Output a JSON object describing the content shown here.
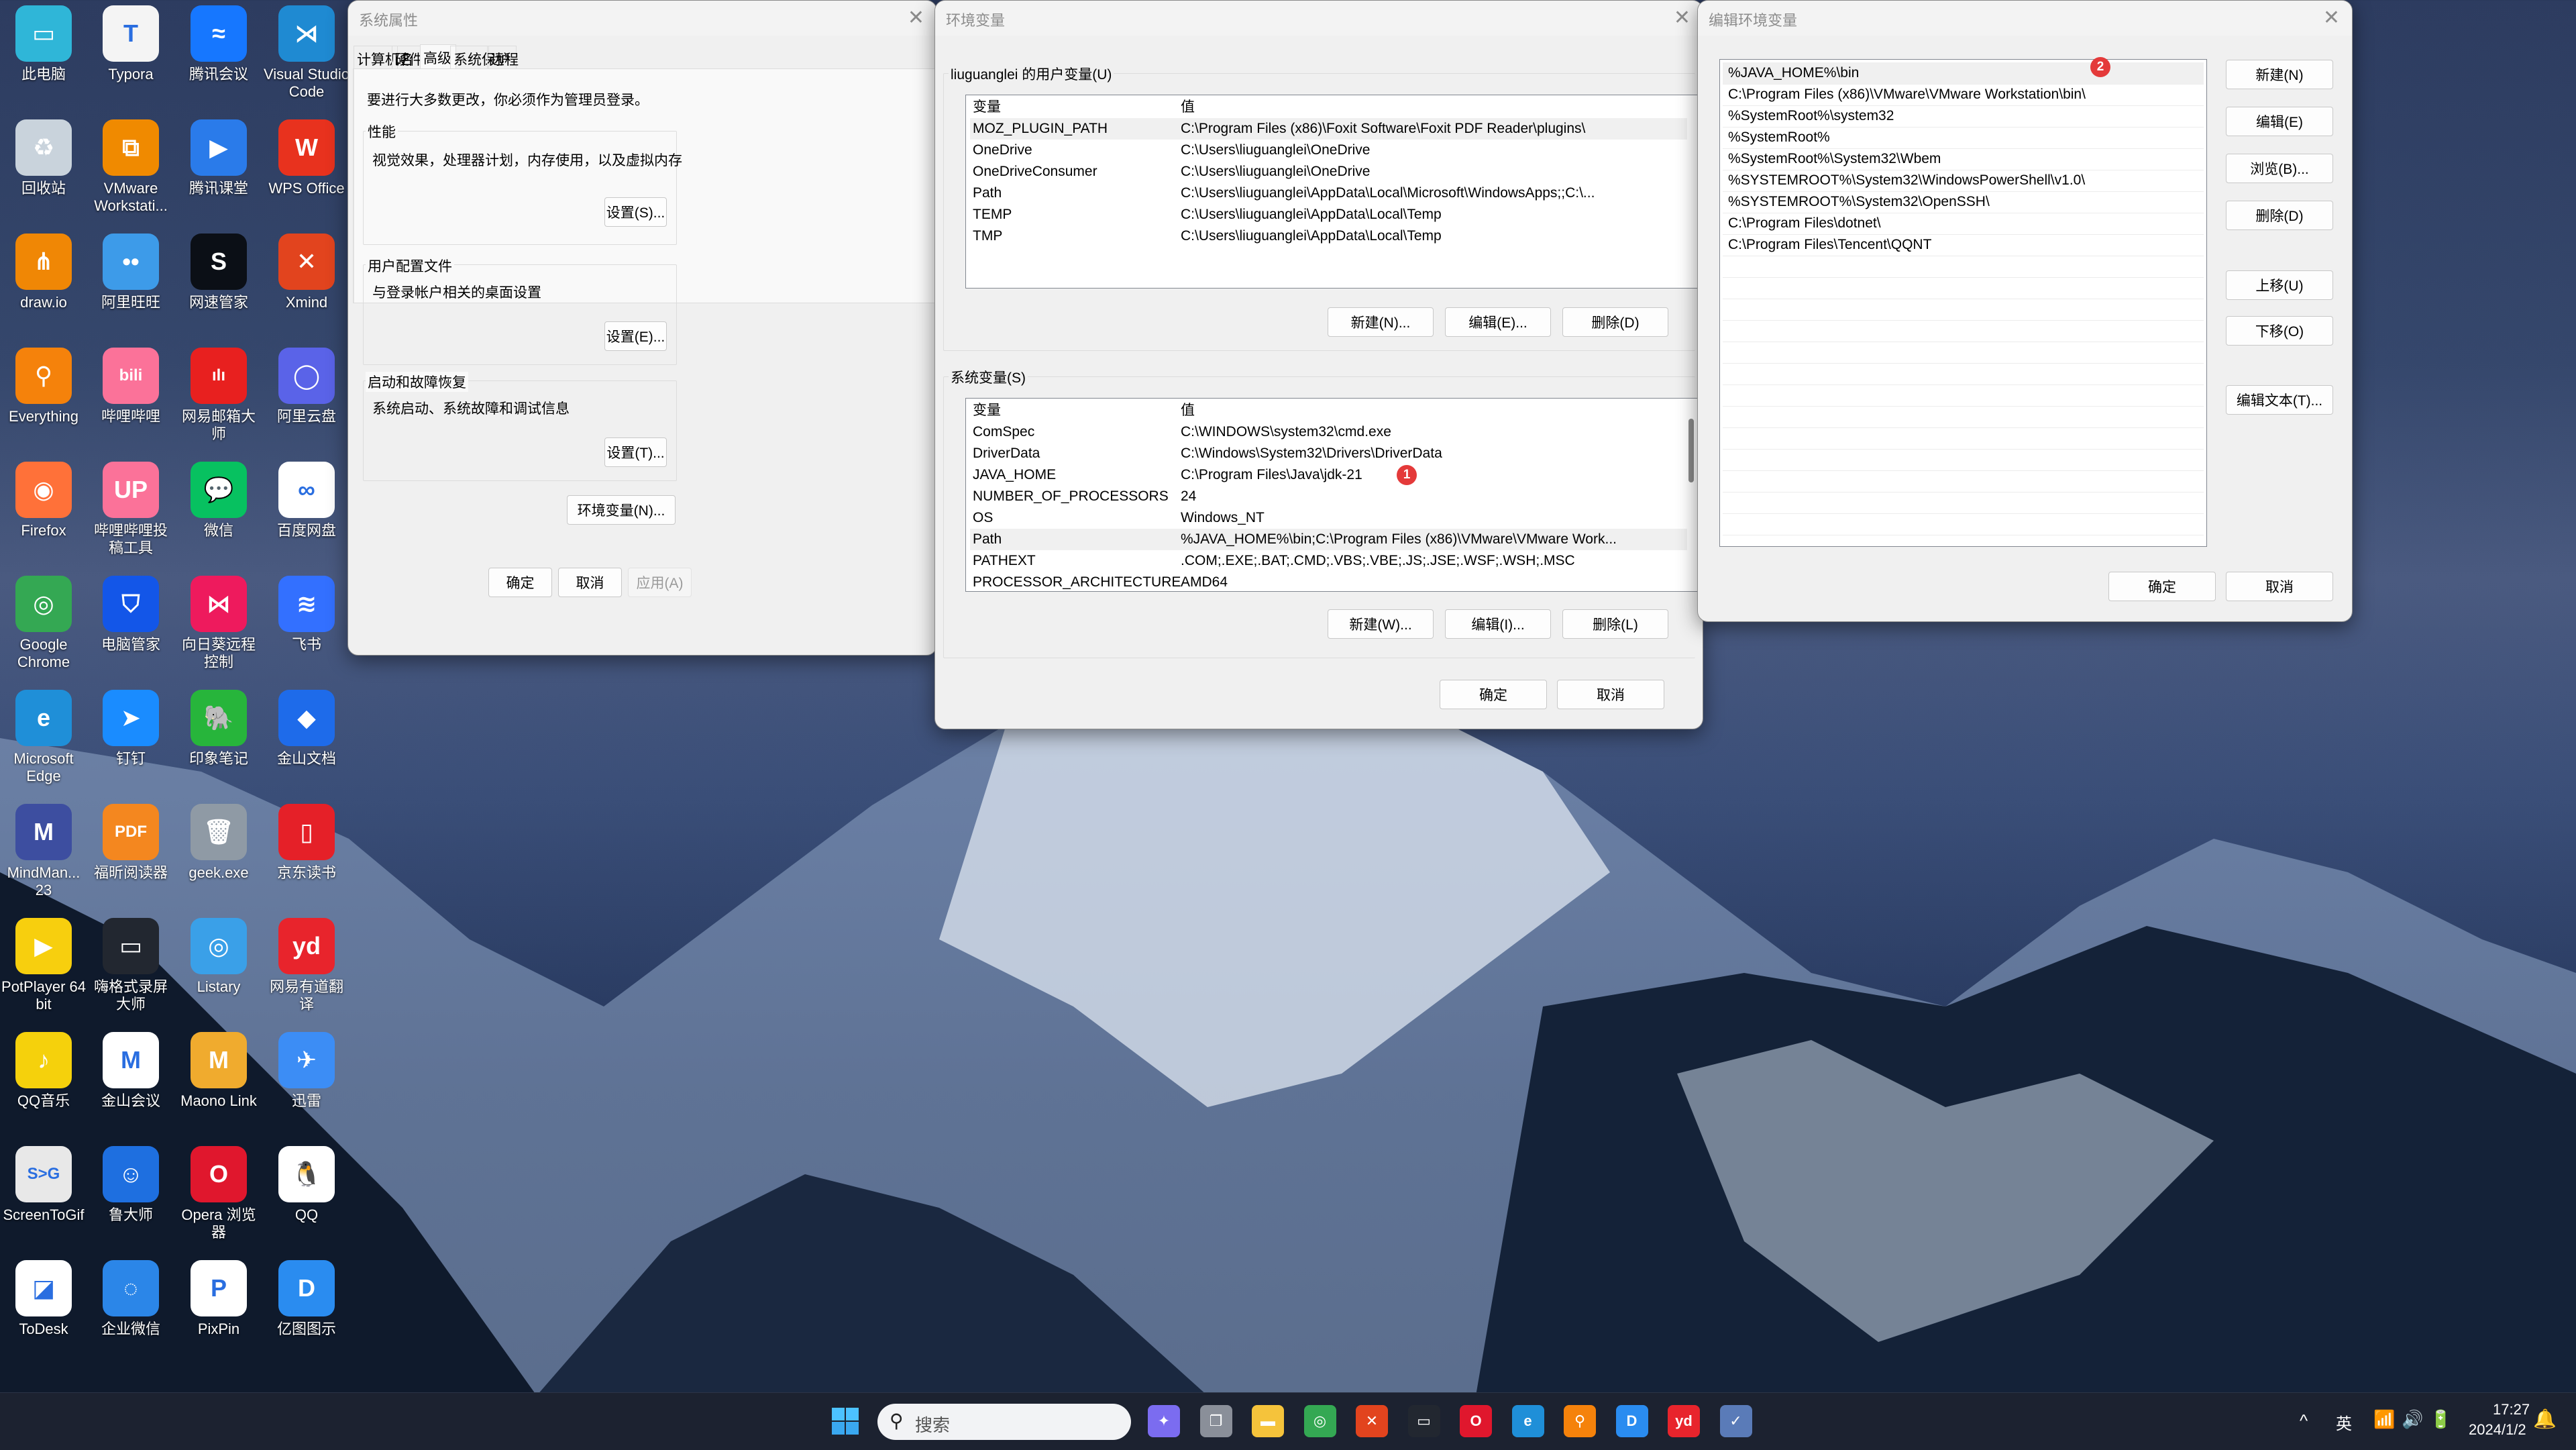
{
  "desktop": {
    "icons": [
      {
        "label": "此电脑",
        "icon": "computer-icon",
        "color": "#2fb6d8",
        "glyph": "▭"
      },
      {
        "label": "Typora",
        "icon": "typora-icon",
        "color": "#f4f4f4",
        "glyph": "T"
      },
      {
        "label": "腾讯会议",
        "icon": "tencent-meeting-icon",
        "color": "#1677ff",
        "glyph": "≈"
      },
      {
        "label": "Visual Studio Code",
        "icon": "vscode-icon",
        "color": "#1f8ad2",
        "glyph": "⋊"
      },
      {
        "label": "回收站",
        "icon": "recycle-bin-icon",
        "color": "#c9d3dc",
        "glyph": "♻"
      },
      {
        "label": "VMware Workstati...",
        "icon": "vmware-icon",
        "color": "#f08a00",
        "glyph": "⧉"
      },
      {
        "label": "腾讯课堂",
        "icon": "tencent-classroom-icon",
        "color": "#2a7bea",
        "glyph": "▶"
      },
      {
        "label": "WPS Office",
        "icon": "wps-icon",
        "color": "#e8321e",
        "glyph": "W"
      },
      {
        "label": "draw.io",
        "icon": "drawio-icon",
        "color": "#f08705",
        "glyph": "⋔"
      },
      {
        "label": "阿里旺旺",
        "icon": "aliwangwang-icon",
        "color": "#3d9be9",
        "glyph": "••"
      },
      {
        "label": "网速管家",
        "icon": "netspeed-icon",
        "color": "#0b0f16",
        "glyph": "S"
      },
      {
        "label": "Xmind",
        "icon": "xmind-icon",
        "color": "#e2441e",
        "glyph": "✕"
      },
      {
        "label": "Everything",
        "icon": "everything-icon",
        "color": "#f5820b",
        "glyph": "⚲"
      },
      {
        "label": "哔哩哔哩",
        "icon": "bilibili-icon",
        "color": "#fb7299",
        "glyph": "bili"
      },
      {
        "label": "网易邮箱大师",
        "icon": "netease-mail-icon",
        "color": "#e8201f",
        "glyph": "ılı"
      },
      {
        "label": "阿里云盘",
        "icon": "aliyun-drive-icon",
        "color": "#5a63e8",
        "glyph": "◯"
      },
      {
        "label": "Firefox",
        "icon": "firefox-icon",
        "color": "#ff7139",
        "glyph": "◉"
      },
      {
        "label": "哔哩哔哩投稿工具",
        "icon": "bilibili-upload-icon",
        "color": "#fb7299",
        "glyph": "UP"
      },
      {
        "label": "微信",
        "icon": "wechat-icon",
        "color": "#07c160",
        "glyph": "💬"
      },
      {
        "label": "百度网盘",
        "icon": "baidu-netdisk-icon",
        "color": "#ffffff",
        "glyph": "∞"
      },
      {
        "label": "Google Chrome",
        "icon": "chrome-icon",
        "color": "#34a853",
        "glyph": "◎"
      },
      {
        "label": "电脑管家",
        "icon": "pc-manager-icon",
        "color": "#1356e8",
        "glyph": "⛉"
      },
      {
        "label": "向日葵远程控制",
        "icon": "sunlogin-icon",
        "color": "#ee1a5d",
        "glyph": "⋈"
      },
      {
        "label": "飞书",
        "icon": "feishu-icon",
        "color": "#3370ff",
        "glyph": "≋"
      },
      {
        "label": "Microsoft Edge",
        "icon": "edge-icon",
        "color": "#1f8fd8",
        "glyph": "e"
      },
      {
        "label": "钉钉",
        "icon": "dingtalk-icon",
        "color": "#1a8cff",
        "glyph": "➤"
      },
      {
        "label": "印象笔记",
        "icon": "evernote-icon",
        "color": "#27b53b",
        "glyph": "🐘"
      },
      {
        "label": "金山文档",
        "icon": "kdocs-icon",
        "color": "#1e6bea",
        "glyph": "◆"
      },
      {
        "label": "MindMan... 23",
        "icon": "mindmanager-icon",
        "color": "#3d4ea0",
        "glyph": "M"
      },
      {
        "label": "福昕阅读器",
        "icon": "foxit-reader-icon",
        "color": "#f4871f",
        "glyph": "PDF"
      },
      {
        "label": "geek.exe",
        "icon": "geek-uninstaller-icon",
        "color": "#8f9aa5",
        "glyph": "🗑"
      },
      {
        "label": "京东读书",
        "icon": "jd-read-icon",
        "color": "#e52028",
        "glyph": "▯"
      },
      {
        "label": "PotPlayer 64 bit",
        "icon": "potplayer-icon",
        "color": "#f7cf0e",
        "glyph": "▶"
      },
      {
        "label": "嗨格式录屏大师",
        "icon": "screen-recorder-icon",
        "color": "#222730",
        "glyph": "▭"
      },
      {
        "label": "Listary",
        "icon": "listary-icon",
        "color": "#3aa0e8",
        "glyph": "◎"
      },
      {
        "label": "网易有道翻译",
        "icon": "youdao-icon",
        "color": "#e8242c",
        "glyph": "yd"
      },
      {
        "label": "QQ音乐",
        "icon": "qqmusic-icon",
        "color": "#f5d10c",
        "glyph": "♪"
      },
      {
        "label": "金山会议",
        "icon": "kmeeting-icon",
        "color": "#ffffff",
        "glyph": "M"
      },
      {
        "label": "Maono Link",
        "icon": "maono-link-icon",
        "color": "#f0ab2e",
        "glyph": "M"
      },
      {
        "label": "迅雷",
        "icon": "xunlei-icon",
        "color": "#3c8df5",
        "glyph": "✈"
      },
      {
        "label": "ScreenToGif",
        "icon": "screentogif-icon",
        "color": "#e8e8e8",
        "glyph": "S>G"
      },
      {
        "label": "鲁大师",
        "icon": "ludashi-icon",
        "color": "#1e6fe0",
        "glyph": "☺"
      },
      {
        "label": "Opera 浏览器",
        "icon": "opera-icon",
        "color": "#e0172d",
        "glyph": "O"
      },
      {
        "label": "QQ",
        "icon": "qq-icon",
        "color": "#ffffff",
        "glyph": "🐧"
      },
      {
        "label": "ToDesk",
        "icon": "todesk-icon",
        "color": "#ffffff",
        "glyph": "◪"
      },
      {
        "label": "企业微信",
        "icon": "wecom-icon",
        "color": "#2b86e8",
        "glyph": "◌"
      },
      {
        "label": "PixPin",
        "icon": "pixpin-icon",
        "color": "#ffffff",
        "glyph": "P"
      },
      {
        "label": "亿图图示",
        "icon": "edraw-icon",
        "color": "#2a8cf0",
        "glyph": "D"
      }
    ]
  },
  "sysprops": {
    "title": "系统属性",
    "tabs": [
      "计算机名",
      "硬件",
      "高级",
      "系统保护",
      "远程"
    ],
    "active_tab": "高级",
    "admin_note": "要进行大多数更改，你必须作为管理员登录。",
    "perf_label": "性能",
    "perf_desc": "视觉效果，处理器计划，内存使用，以及虚拟内存",
    "perf_btn": "设置(S)...",
    "profile_label": "用户配置文件",
    "profile_desc": "与登录帐户相关的桌面设置",
    "profile_btn": "设置(E)...",
    "startup_label": "启动和故障恢复",
    "startup_desc": "系统启动、系统故障和调试信息",
    "startup_btn": "设置(T)...",
    "env_btn": "环境变量(N)...",
    "ok": "确定",
    "cancel": "取消",
    "apply": "应用(A)"
  },
  "envvars": {
    "title": "环境变量",
    "user_label": "liuguanglei 的用户变量(U)",
    "col_var": "变量",
    "col_val": "值",
    "user_vars": [
      {
        "name": "MOZ_PLUGIN_PATH",
        "value": "C:\\Program Files (x86)\\Foxit Software\\Foxit PDF Reader\\plugins\\"
      },
      {
        "name": "OneDrive",
        "value": "C:\\Users\\liuguanglei\\OneDrive"
      },
      {
        "name": "OneDriveConsumer",
        "value": "C:\\Users\\liuguanglei\\OneDrive"
      },
      {
        "name": "Path",
        "value": "C:\\Users\\liuguanglei\\AppData\\Local\\Microsoft\\WindowsApps;;C:\\..."
      },
      {
        "name": "TEMP",
        "value": "C:\\Users\\liuguanglei\\AppData\\Local\\Temp"
      },
      {
        "name": "TMP",
        "value": "C:\\Users\\liuguanglei\\AppData\\Local\\Temp"
      }
    ],
    "user_new": "新建(N)...",
    "user_edit": "编辑(E)...",
    "user_delete": "删除(D)",
    "sys_label": "系统变量(S)",
    "sys_vars": [
      {
        "name": "ComSpec",
        "value": "C:\\WINDOWS\\system32\\cmd.exe"
      },
      {
        "name": "DriverData",
        "value": "C:\\Windows\\System32\\Drivers\\DriverData"
      },
      {
        "name": "JAVA_HOME",
        "value": "C:\\Program Files\\Java\\jdk-21"
      },
      {
        "name": "NUMBER_OF_PROCESSORS",
        "value": "24"
      },
      {
        "name": "OS",
        "value": "Windows_NT"
      },
      {
        "name": "Path",
        "value": "%JAVA_HOME%\\bin;C:\\Program Files (x86)\\VMware\\VMware Work..."
      },
      {
        "name": "PATHEXT",
        "value": ".COM;.EXE;.BAT;.CMD;.VBS;.VBE;.JS;.JSE;.WSF;.WSH;.MSC"
      },
      {
        "name": "PROCESSOR_ARCHITECTURE",
        "value": "AMD64"
      }
    ],
    "sys_selected": "Path",
    "badge1": "1",
    "sys_new": "新建(W)...",
    "sys_edit": "编辑(I)...",
    "sys_delete": "删除(L)",
    "ok": "确定",
    "cancel": "取消"
  },
  "editenv": {
    "title": "编辑环境变量",
    "entries": [
      "%JAVA_HOME%\\bin",
      "C:\\Program Files (x86)\\VMware\\VMware Workstation\\bin\\",
      "%SystemRoot%\\system32",
      "%SystemRoot%",
      "%SystemRoot%\\System32\\Wbem",
      "%SYSTEMROOT%\\System32\\WindowsPowerShell\\v1.0\\",
      "%SYSTEMROOT%\\System32\\OpenSSH\\",
      "C:\\Program Files\\dotnet\\",
      "C:\\Program Files\\Tencent\\QQNT"
    ],
    "selected_index": 0,
    "badge2": "2",
    "new": "新建(N)",
    "edit": "编辑(E)",
    "browse": "浏览(B)...",
    "delete": "删除(D)",
    "up": "上移(U)",
    "down": "下移(O)",
    "edit_text": "编辑文本(T)...",
    "ok": "确定",
    "cancel": "取消"
  },
  "taskbar": {
    "search_placeholder": "搜索",
    "apps": [
      {
        "icon": "copilot-icon",
        "color": "#7b6cf0",
        "glyph": "✦"
      },
      {
        "icon": "task-view-icon",
        "color": "#8a8f99",
        "glyph": "❐"
      },
      {
        "icon": "file-explorer-icon",
        "color": "#f5c33b",
        "glyph": "▬"
      },
      {
        "icon": "chrome-icon",
        "color": "#34a853",
        "glyph": "◎"
      },
      {
        "icon": "xmind-icon",
        "color": "#e2441e",
        "glyph": "✕"
      },
      {
        "icon": "screen-recorder-icon",
        "color": "#222730",
        "glyph": "▭"
      },
      {
        "icon": "opera-icon",
        "color": "#e0172d",
        "glyph": "O"
      },
      {
        "icon": "edge-icon",
        "color": "#1f8fd8",
        "glyph": "e"
      },
      {
        "icon": "everything-icon",
        "color": "#f5820b",
        "glyph": "⚲"
      },
      {
        "icon": "edraw-icon",
        "color": "#2a8cf0",
        "glyph": "D"
      },
      {
        "icon": "youdao-icon",
        "color": "#e8242c",
        "glyph": "yd"
      },
      {
        "icon": "system-properties-icon",
        "color": "#5a7bb8",
        "glyph": "✓"
      }
    ],
    "tray_chevron": "^",
    "ime": "英",
    "time": "17:27",
    "date": "2024/1/2"
  }
}
